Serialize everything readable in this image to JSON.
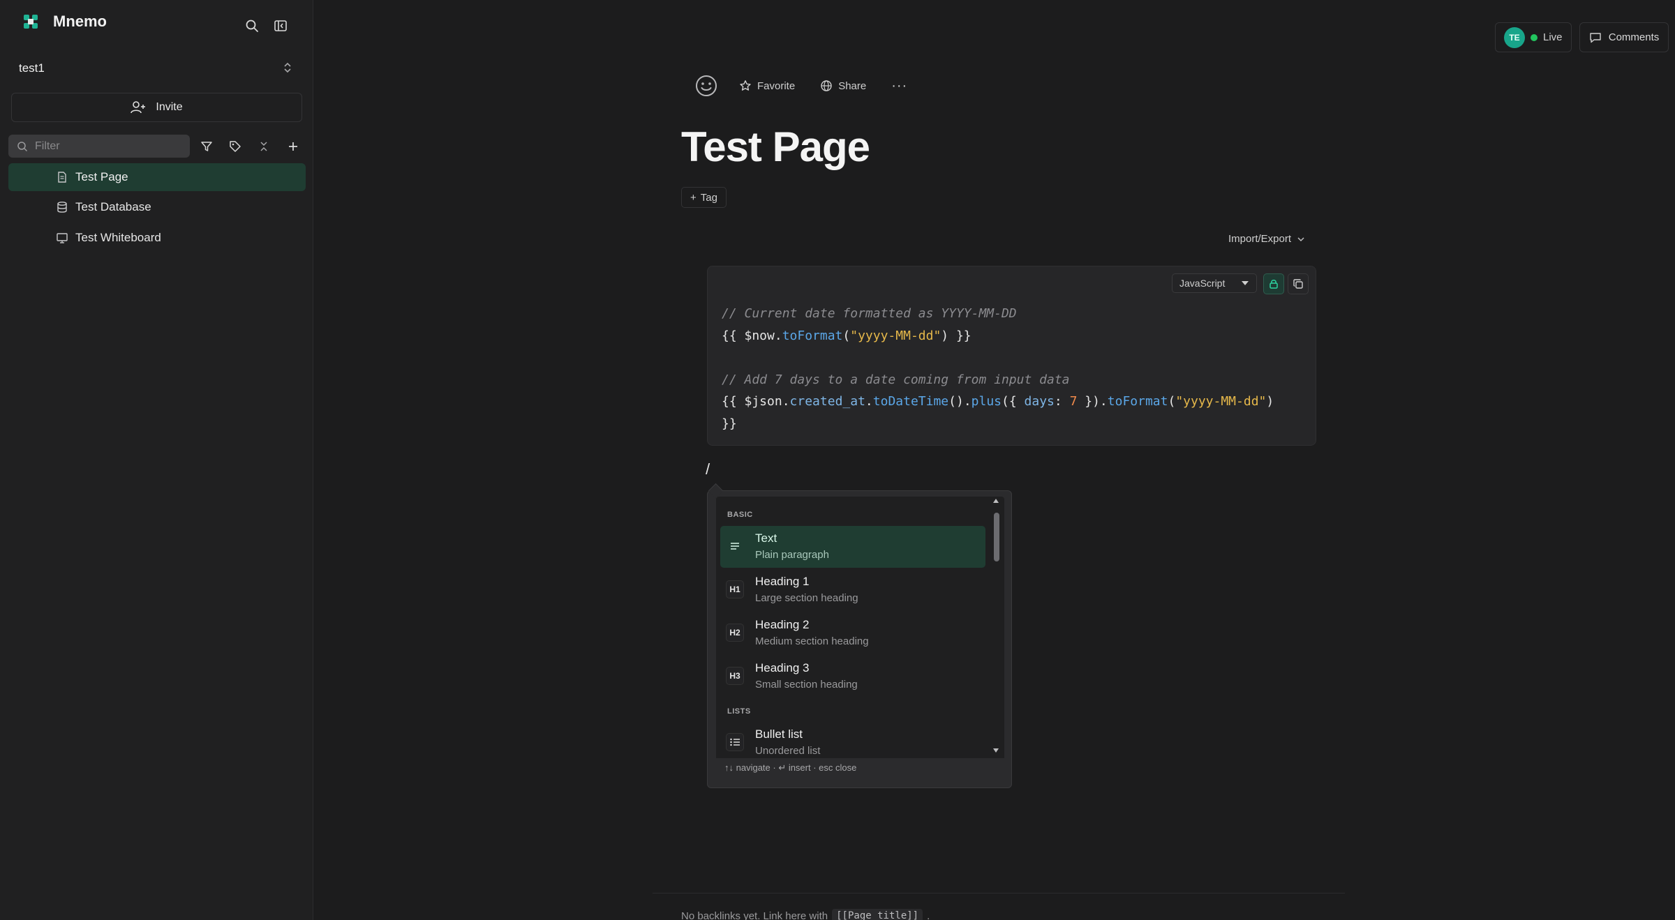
{
  "app": {
    "name": "Mnemo"
  },
  "sidebar": {
    "workspace": "test1",
    "invite_label": "Invite",
    "filter_placeholder": "Filter",
    "items": [
      {
        "label": "Test Page",
        "icon": "page-icon",
        "active": true
      },
      {
        "label": "Test Database",
        "icon": "database-icon",
        "active": false
      },
      {
        "label": "Test Whiteboard",
        "icon": "whiteboard-icon",
        "active": false
      }
    ]
  },
  "header": {
    "avatar_initials": "TE",
    "live_label": "Live",
    "comments_label": "Comments"
  },
  "toolbar": {
    "favorite_label": "Favorite",
    "share_label": "Share",
    "more_label": "···"
  },
  "page": {
    "title": "Test Page",
    "tag_label": "Tag",
    "import_export_label": "Import/Export"
  },
  "code_block": {
    "language": "JavaScript",
    "lines": [
      "// Current date formatted as YYYY-MM-DD",
      "{{ $now.toFormat(\"yyyy-MM-dd\") }}",
      "",
      "// Add 7 days to a date coming from input data",
      "{{ $json.created_at.toDateTime().plus({ days: 7 }).toFormat(\"yyyy-MM-dd\")",
      "}}"
    ]
  },
  "editor": {
    "slash_text": "/"
  },
  "slash_menu": {
    "sections": {
      "basic": "BASIC",
      "lists": "LISTS"
    },
    "items": [
      {
        "title": "Text",
        "desc": "Plain paragraph",
        "icon": "text-icon"
      },
      {
        "title": "Heading 1",
        "desc": "Large section heading",
        "icon_text": "H1"
      },
      {
        "title": "Heading 2",
        "desc": "Medium section heading",
        "icon_text": "H2"
      },
      {
        "title": "Heading 3",
        "desc": "Small section heading",
        "icon_text": "H3"
      },
      {
        "title": "Bullet list",
        "desc": "Unordered list",
        "icon": "bullet-list-icon"
      }
    ],
    "footer": "↑↓ navigate · ↵ insert · esc close"
  },
  "backlinks": {
    "text": "No backlinks yet. Link here with",
    "code": "[[Page title]]",
    "suffix": "."
  },
  "colors": {
    "accent": "#18a58a",
    "active_bg": "#1f3d32",
    "live": "#22c55e"
  }
}
